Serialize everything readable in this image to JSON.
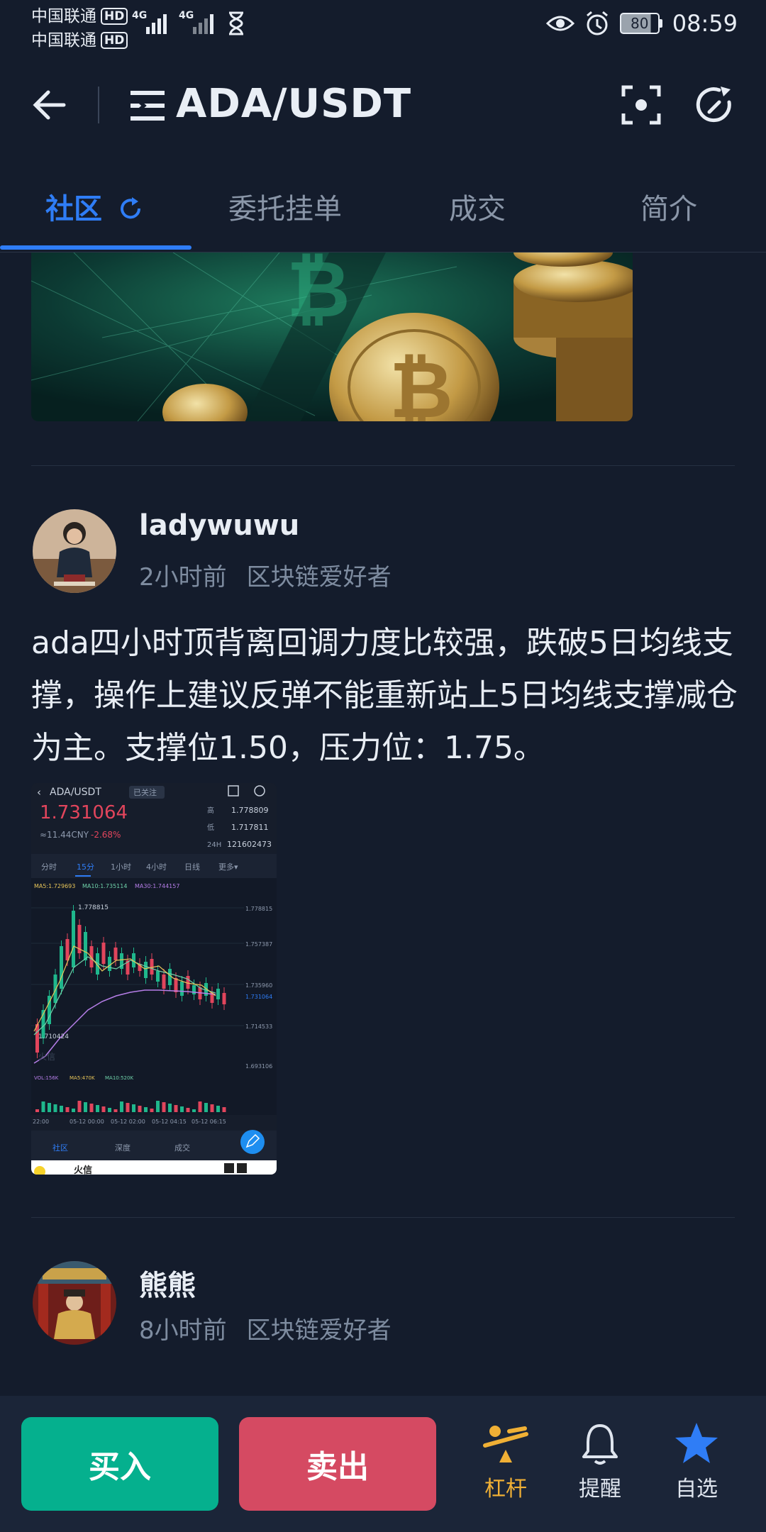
{
  "status_bar": {
    "carrier1": "中国联通",
    "carrier2": "中国联通",
    "hd": "HD",
    "network": "4G",
    "battery": "80",
    "time": "08:59"
  },
  "header": {
    "title": "ADA/USDT"
  },
  "tabs": [
    {
      "label": "社区"
    },
    {
      "label": "委托挂单"
    },
    {
      "label": "成交"
    },
    {
      "label": "简介"
    }
  ],
  "posts": [
    {
      "username": "ladywuwu",
      "time": "2小时前",
      "tag": "区块链爱好者",
      "text": "ada四小时顶背离回调力度比较强，跌破5日均线支撑，操作上建议反弹不能重新站上5日均线支撑减仓为主。支撑位1.50，压力位：1.75。"
    },
    {
      "username": "熊熊",
      "time": "8小时前",
      "tag": "区块链爱好者"
    }
  ],
  "embedded_screenshot": {
    "pair": "ADA/USDT",
    "followed": "已关注",
    "price": "1.731064",
    "cny": "≈11.44CNY",
    "change": "-2.68%",
    "high_label": "高",
    "high": "1.778809",
    "low_label": "低",
    "low": "1.717811",
    "vol_label": "24H",
    "vol": "121602473",
    "periods": [
      "分时",
      "15分",
      "1小时",
      "4小时",
      "日线",
      "更多▾"
    ],
    "ma5": "MA5:1.729693",
    "ma10": "MA10:1.735114",
    "ma30": "MA30:1.744157",
    "peak_label": "1.778815",
    "low_mark": "1.710424",
    "axis": [
      "1.778815",
      "1.757387",
      "1.735960",
      "1.731064",
      "1.714533",
      "1.693106"
    ],
    "vol_ma": [
      "VOL:156K",
      "MA5:470K",
      "MA10:520K"
    ],
    "times": [
      "22:00",
      "05-12 00:00",
      "05-12 02:00",
      "05-12 04:15",
      "05-12 06:15"
    ],
    "bottom_tabs": [
      "社区",
      "深度",
      "成交"
    ],
    "watermark": "火信",
    "footer": "火信"
  },
  "bottom_bar": {
    "buy": "买入",
    "sell": "卖出",
    "leverage": "杠杆",
    "alert": "提醒",
    "favorite": "自选"
  },
  "colors": {
    "background": "#141c2c",
    "accent": "#2f7df6",
    "buy": "#05b08e",
    "sell": "#d54a62",
    "leverage": "#f0b035"
  }
}
